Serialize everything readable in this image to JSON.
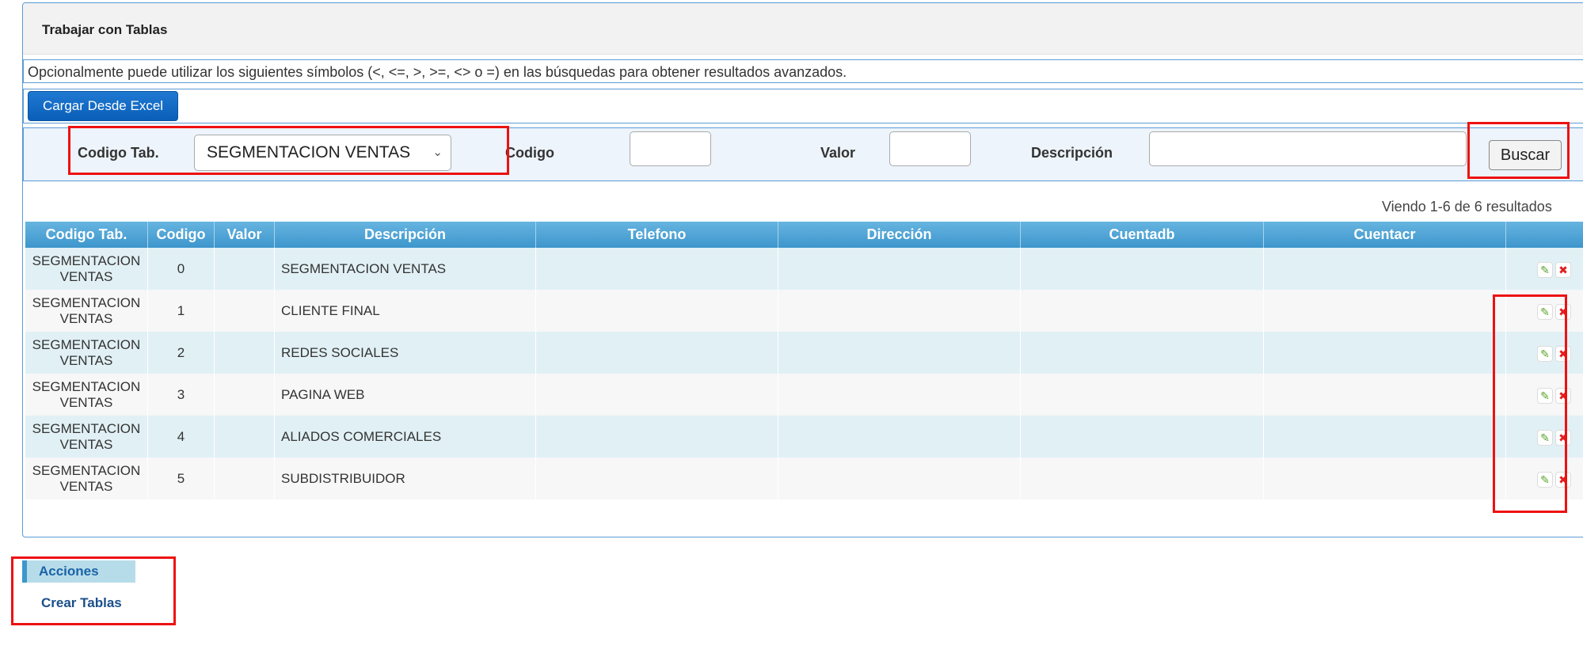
{
  "panel": {
    "title": "Trabajar con Tablas",
    "info": "Opcionalmente puede utilizar los siguientes símbolos (<, <=, >, >=, <> o =) en las búsquedas para obtener resultados avanzados.",
    "excel_button": "Cargar Desde Excel"
  },
  "filters": {
    "codigo_tab_label": "Codigo Tab.",
    "codigo_tab_value": "SEGMENTACION VENTAS",
    "codigo_label": "Codigo",
    "valor_label": "Valor",
    "descripcion_label": "Descripción",
    "search_button": "Buscar"
  },
  "results": {
    "summary": "Viendo 1-6 de 6 resultados"
  },
  "table": {
    "columns": [
      "Codigo Tab.",
      "Codigo",
      "Valor",
      "Descripción",
      "Telefono",
      "Dirección",
      "Cuentadb",
      "Cuentacr",
      ""
    ],
    "rows": [
      {
        "codigo_tab": "SEGMENTACION VENTAS",
        "codigo": "0",
        "valor": "",
        "descripcion": "SEGMENTACION VENTAS",
        "telefono": "",
        "direccion": "",
        "cuentadb": "",
        "cuentacr": ""
      },
      {
        "codigo_tab": "SEGMENTACION VENTAS",
        "codigo": "1",
        "valor": "",
        "descripcion": "CLIENTE FINAL",
        "telefono": "",
        "direccion": "",
        "cuentadb": "",
        "cuentacr": ""
      },
      {
        "codigo_tab": "SEGMENTACION VENTAS",
        "codigo": "2",
        "valor": "",
        "descripcion": "REDES SOCIALES",
        "telefono": "",
        "direccion": "",
        "cuentadb": "",
        "cuentacr": ""
      },
      {
        "codigo_tab": "SEGMENTACION VENTAS",
        "codigo": "3",
        "valor": "",
        "descripcion": "PAGINA WEB",
        "telefono": "",
        "direccion": "",
        "cuentadb": "",
        "cuentacr": ""
      },
      {
        "codigo_tab": "SEGMENTACION VENTAS",
        "codigo": "4",
        "valor": "",
        "descripcion": "ALIADOS COMERCIALES",
        "telefono": "",
        "direccion": "",
        "cuentadb": "",
        "cuentacr": ""
      },
      {
        "codigo_tab": "SEGMENTACION VENTAS",
        "codigo": "5",
        "valor": "",
        "descripcion": "SUBDISTRIBUIDOR",
        "telefono": "",
        "direccion": "",
        "cuentadb": "",
        "cuentacr": ""
      }
    ],
    "row_actions": {
      "edit_icon": "pencil-icon",
      "delete_icon": "x-icon"
    }
  },
  "sidebar": {
    "heading": "Acciones",
    "items": [
      {
        "label": "Crear Tablas"
      }
    ]
  },
  "colors": {
    "accent": "#3d96cc",
    "highlight": "#ee1111",
    "button_blue": "#0a5fb8"
  }
}
